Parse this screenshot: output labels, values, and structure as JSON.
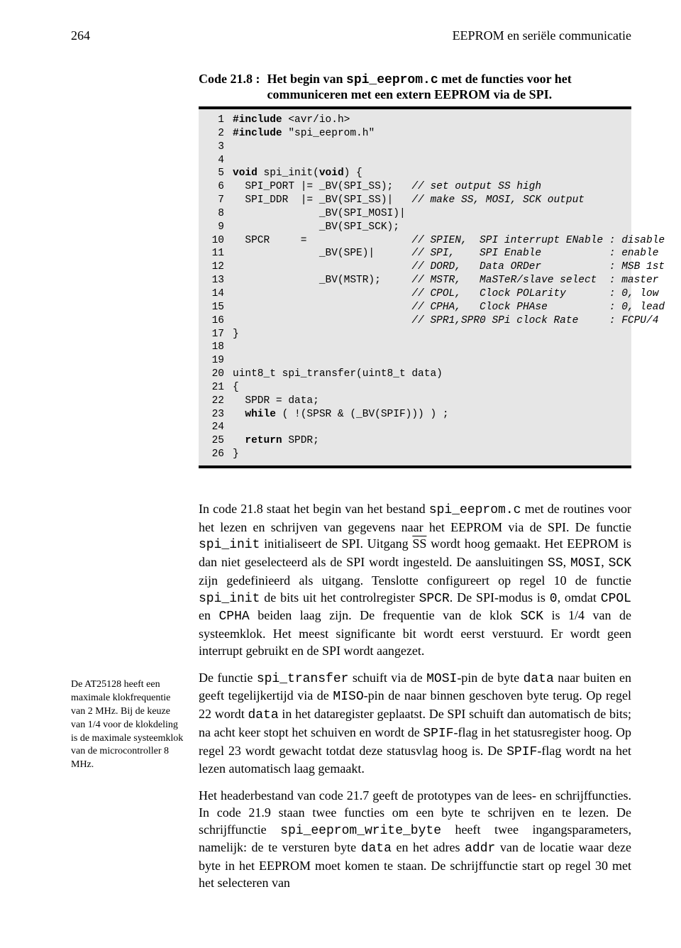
{
  "header": {
    "page_number": "264",
    "chapter_title": "EEPROM en seriële communicatie"
  },
  "code_listing": {
    "label": "Code 21.8 :",
    "caption_pre": "Het begin van ",
    "caption_code": "spi_eeprom.c",
    "caption_post": " met de functies voor het communiceren met een extern EEPROM via de SPI.",
    "lines": [
      {
        "n": "1",
        "pre": "#include ",
        "rest": "<avr/io.h>"
      },
      {
        "n": "2",
        "pre": "#include ",
        "rest": "\"spi_eeprom.h\""
      },
      {
        "n": "3",
        "pre": "",
        "rest": ""
      },
      {
        "n": "4",
        "pre": "",
        "rest": ""
      },
      {
        "n": "5",
        "pre": "void ",
        "mid": "spi_init(",
        "kw2": "void",
        "rest": ") {"
      },
      {
        "n": "6",
        "plain": "  SPI_PORT |= _BV(SPI_SS);   ",
        "cm": "// set output SS high"
      },
      {
        "n": "7",
        "plain": "  SPI_DDR  |= _BV(SPI_SS)|   ",
        "cm": "// make SS, MOSI, SCK output"
      },
      {
        "n": "8",
        "plain": "              _BV(SPI_MOSI)|"
      },
      {
        "n": "9",
        "plain": "              _BV(SPI_SCK);"
      },
      {
        "n": "10",
        "plain": "  SPCR     =                 ",
        "cm": "// SPIEN,  SPI interrupt ENable : disable"
      },
      {
        "n": "11",
        "plain": "              _BV(SPE)|      ",
        "cm": "// SPI,    SPI Enable           : enable"
      },
      {
        "n": "12",
        "plain": "                             ",
        "cm": "// DORD,   Data ORDer           : MSB 1st"
      },
      {
        "n": "13",
        "plain": "              _BV(MSTR);     ",
        "cm": "// MSTR,   MaSTeR/slave select  : master"
      },
      {
        "n": "14",
        "plain": "                             ",
        "cm": "// CPOL,   Clock POLarity       : 0, low"
      },
      {
        "n": "15",
        "plain": "                             ",
        "cm": "// CPHA,   Clock PHAse          : 0, lead"
      },
      {
        "n": "16",
        "plain": "                             ",
        "cm": "// SPR1,SPR0 SPi clock Rate     : FCPU/4"
      },
      {
        "n": "17",
        "plain": "}"
      },
      {
        "n": "18",
        "plain": ""
      },
      {
        "n": "19",
        "plain": ""
      },
      {
        "n": "20",
        "plain": "uint8_t spi_transfer(uint8_t data)"
      },
      {
        "n": "21",
        "plain": "{"
      },
      {
        "n": "22",
        "plain": "  SPDR = data;"
      },
      {
        "n": "23",
        "pre": "  ",
        "kw": "while",
        "rest": " ( !(SPSR & (_BV(SPIF))) ) ;"
      },
      {
        "n": "24",
        "plain": ""
      },
      {
        "n": "25",
        "pre": "  ",
        "kw": "return",
        "rest": " SPDR;"
      },
      {
        "n": "26",
        "plain": "}"
      }
    ]
  },
  "margin_note": "De AT25128 heeft een maximale klokfrequentie van 2 MHz. Bij de keuze van 1/4 voor de klokdeling is de maximale systeemklok van de microcontroller 8 MHz.",
  "body": {
    "p1_a": "In code 21.8 staat het begin van het bestand ",
    "p1_code1": "spi_eeprom.c",
    "p1_b": " met de routines voor het lezen en schrijven van gegevens naar het EEPROM via de SPI. De functie ",
    "p1_code2": "spi_init",
    "p1_c": " initialiseert de SPI. Uitgang ",
    "p1_ss": "SS",
    "p1_d": " wordt hoog gemaakt. Het EEPROM is dan niet geselecteerd als de SPI wordt ingesteld. De aansluitingen ",
    "p1_code3": "SS",
    "p1_e": ", ",
    "p1_code4": "MOSI",
    "p1_f": ", ",
    "p1_code5": "SCK",
    "p1_g": " zijn gedefinieerd als uitgang. Tenslotte configureert op regel 10 de functie ",
    "p1_code6": "spi_init",
    "p1_h": " de bits uit het controlregister ",
    "p1_code7": "SPCR",
    "p1_i": ". De SPI-modus is ",
    "p1_code8": "0",
    "p1_j": ", omdat ",
    "p1_code9": "CPOL",
    "p1_k": " en ",
    "p1_code10": "CPHA",
    "p1_l": " beiden laag zijn. De frequentie van de klok ",
    "p1_code11": "SCK",
    "p1_m": " is 1/4 van de systeemklok. Het meest significante bit wordt eerst verstuurd. Er wordt geen interrupt gebruikt en de SPI wordt aangezet.",
    "p2_a": "De functie ",
    "p2_code1": "spi_transfer",
    "p2_b": " schuift via de ",
    "p2_code2": "MOSI",
    "p2_c": "-pin de byte ",
    "p2_code3": "data",
    "p2_d": " naar buiten en geeft tegelijkertijd via de ",
    "p2_code4": "MISO",
    "p2_e": "-pin de naar binnen geschoven byte terug. Op regel 22 wordt ",
    "p2_code5": "data",
    "p2_f": " in het dataregister geplaatst. De SPI schuift dan automatisch de bits; na acht keer stopt het schuiven en wordt de ",
    "p2_code6": "SPIF",
    "p2_g": "-flag in het statusregister hoog. Op regel 23 wordt gewacht totdat deze statusvlag hoog is. De ",
    "p2_code7": "SPIF",
    "p2_h": "-flag wordt na het lezen automatisch laag gemaakt.",
    "p3_a": "Het headerbestand van code 21.7 geeft de prototypes van de lees- en schrijffuncties. In code 21.9 staan twee functies om een byte te schrijven en te lezen. De schrijffunctie ",
    "p3_code1": "spi_eeprom_write_byte",
    "p3_b": " heeft twee ingangsparameters, namelijk: de te versturen byte ",
    "p3_code2": "data",
    "p3_c": " en het adres ",
    "p3_code3": "addr",
    "p3_d": " van de locatie waar deze byte in het EEPROM moet komen te staan. De schrijffunctie start op regel 30 met het selecteren van"
  }
}
